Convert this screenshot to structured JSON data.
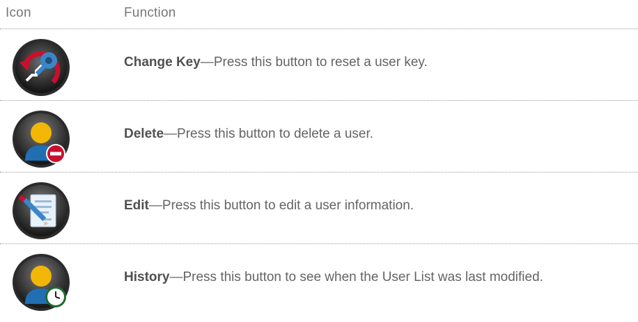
{
  "header": {
    "icon_label": "Icon",
    "function_label": "Function"
  },
  "rows": [
    {
      "icon": "change-key-icon",
      "term": "Change Key",
      "dash": "—",
      "text": "Press this button to reset a user key."
    },
    {
      "icon": "delete-user-icon",
      "term": "Delete",
      "dash": "—",
      "text": "Press this button to delete a user."
    },
    {
      "icon": "edit-user-icon",
      "term": "Edit",
      "dash": "—",
      "text": "Press this button to edit a user information."
    },
    {
      "icon": "history-icon",
      "term": "History",
      "dash": "—",
      "text": "Press this button to see when the User List was last modified."
    }
  ],
  "colors": {
    "text": "#636466",
    "divider": "#9a9a9a",
    "accent_red": "#c8102e",
    "user_blue": "#1f6fb2",
    "user_yellow": "#f2b705"
  }
}
